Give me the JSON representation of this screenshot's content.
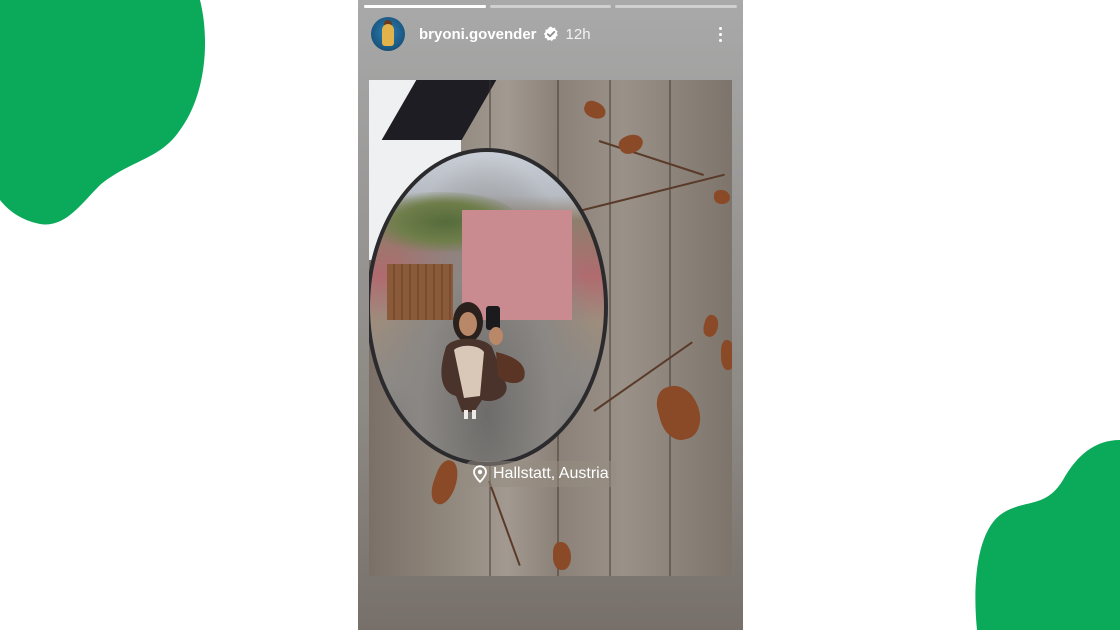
{
  "colors": {
    "accent_green": "#0aaa5a",
    "story_bg": "#9a9998",
    "verified_badge": "#ffffff"
  },
  "story": {
    "progress": [
      1.0,
      0.0,
      0.0
    ],
    "username": "bryoni.govender",
    "verified": true,
    "time_ago": "12h",
    "menu_icon": "more-vertical-icon",
    "location_sticker": {
      "icon": "location-pin-icon",
      "text": "Hallstatt, Austria"
    }
  }
}
